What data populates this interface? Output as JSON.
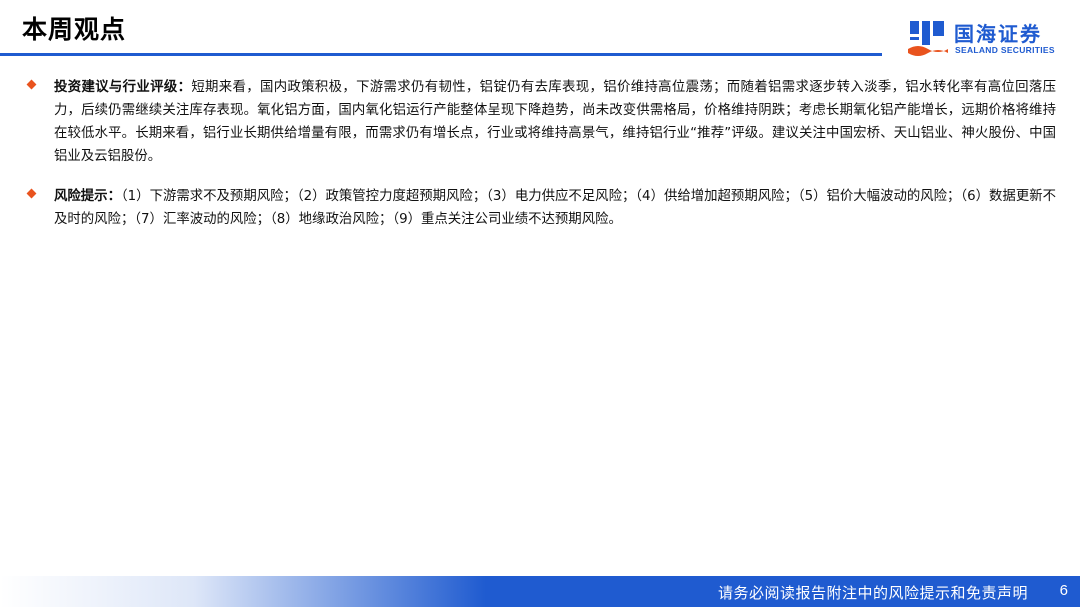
{
  "header": {
    "title": "本周观点"
  },
  "logo": {
    "name_cn": "国海证券",
    "name_en": "SEALAND SECURITIES",
    "brand_color": "#1f5bd0",
    "icon": "sealand-logo-icon"
  },
  "bullets": [
    {
      "heading": "投资建议与行业评级：",
      "text": "短期来看，国内政策积极，下游需求仍有韧性，铝锭仍有去库表现，铝价维持高位震荡；而随着铝需求逐步转入淡季，铝水转化率有高位回落压力，后续仍需继续关注库存表现。氧化铝方面，国内氧化铝运行产能整体呈现下降趋势，尚未改变供需格局，价格维持阴跌；考虑长期氧化铝产能增长，远期价格将维持在较低水平。长期来看，铝行业长期供给增量有限，而需求仍有增长点，行业或将维持高景气，维持铝行业“推荐”评级。建议关注中国宏桥、天山铝业、神火股份、中国铝业及云铝股份。"
    },
    {
      "heading": "风险提示：",
      "text": "（1）下游需求不及预期风险；（2）政策管控力度超预期风险；（3）电力供应不足风险；（4）供给增加超预期风险；（5）铝价大幅波动的风险；（6）数据更新不及时的风险；（7）汇率波动的风险；（8）地缘政治风险；（9）重点关注公司业绩不达预期风险。"
    }
  ],
  "footer": {
    "disclaimer": "请务必阅读报告附注中的风险提示和免责声明",
    "page": "6"
  },
  "colors": {
    "accent": "#1f5bd0",
    "bullet": "#e9531e"
  }
}
